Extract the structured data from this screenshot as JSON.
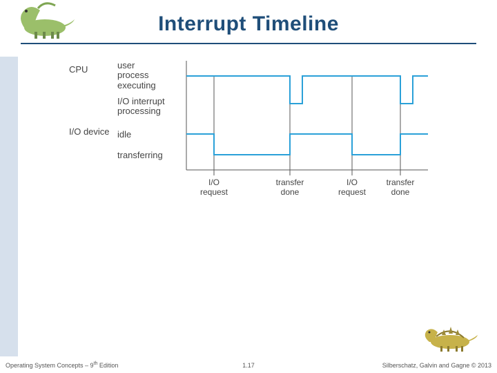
{
  "title": "Interrupt Timeline",
  "footer": {
    "left_prefix": "Operating System Concepts – 9",
    "left_suffix": " Edition",
    "left_sup": "th",
    "center": "1.17",
    "right": "Silberschatz, Galvin and Gagne © 2013"
  },
  "diagram": {
    "row_labels": {
      "cpu": "CPU",
      "io": "I/O\ndevice"
    },
    "cpu_states": {
      "user": "user\nprocess\nexecuting",
      "interrupt": "I/O interrupt\nprocessing"
    },
    "io_states": {
      "idle": "idle",
      "transferring": "transferring"
    },
    "xticks": [
      "I/O\nrequest",
      "transfer\ndone",
      "I/O\nrequest",
      "transfer\ndone"
    ]
  },
  "chart_data": {
    "type": "line",
    "title": "Interrupt Timeline",
    "x_events": [
      "I/O request",
      "transfer done",
      "I/O request",
      "transfer done"
    ],
    "series": [
      {
        "name": "CPU",
        "levels": [
          "user process executing",
          "I/O interrupt processing"
        ],
        "sequence": [
          "user",
          "user",
          "interrupt",
          "user",
          "user",
          "interrupt",
          "user"
        ]
      },
      {
        "name": "I/O device",
        "levels": [
          "idle",
          "transferring"
        ],
        "sequence": [
          "idle",
          "transferring",
          "idle",
          "idle",
          "transferring",
          "idle",
          "idle"
        ]
      }
    ]
  }
}
